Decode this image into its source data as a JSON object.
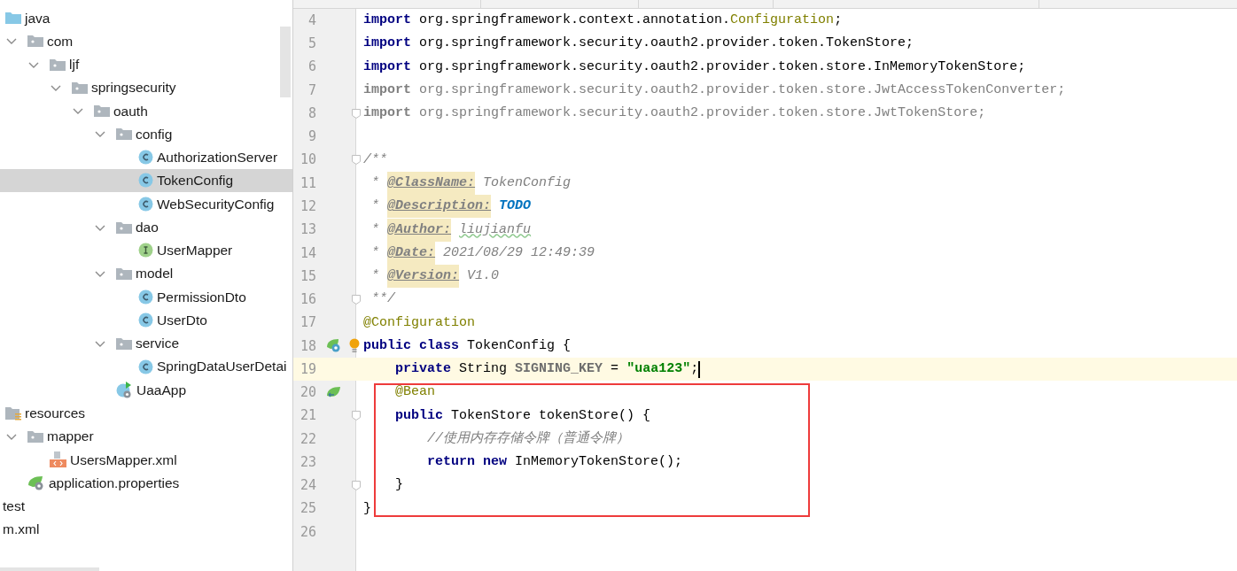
{
  "project_tree": {
    "nodes": [
      {
        "label": "java",
        "kind": "source-folder",
        "selected": false,
        "children": [
          {
            "label": "com",
            "kind": "folder",
            "selected": false,
            "expanded": true,
            "children": [
              {
                "label": "ljf",
                "kind": "folder",
                "selected": false,
                "expanded": true,
                "children": [
                  {
                    "label": "springsecurity",
                    "kind": "folder",
                    "selected": false,
                    "expanded": true,
                    "children": [
                      {
                        "label": "oauth",
                        "kind": "folder",
                        "selected": false,
                        "expanded": true,
                        "children": [
                          {
                            "label": "config",
                            "kind": "folder",
                            "selected": false,
                            "expanded": true,
                            "children": [
                              {
                                "label": "AuthorizationServer",
                                "kind": "class",
                                "selected": false
                              },
                              {
                                "label": "TokenConfig",
                                "kind": "class",
                                "selected": true
                              },
                              {
                                "label": "WebSecurityConfig",
                                "kind": "class",
                                "selected": false
                              }
                            ]
                          },
                          {
                            "label": "dao",
                            "kind": "folder",
                            "selected": false,
                            "expanded": true,
                            "children": [
                              {
                                "label": "UserMapper",
                                "kind": "interface",
                                "selected": false
                              }
                            ]
                          },
                          {
                            "label": "model",
                            "kind": "folder",
                            "selected": false,
                            "expanded": true,
                            "children": [
                              {
                                "label": "PermissionDto",
                                "kind": "class",
                                "selected": false
                              },
                              {
                                "label": "UserDto",
                                "kind": "class",
                                "selected": false
                              }
                            ]
                          },
                          {
                            "label": "service",
                            "kind": "folder",
                            "selected": false,
                            "expanded": true,
                            "children": [
                              {
                                "label": "SpringDataUserDetai",
                                "kind": "class",
                                "selected": false
                              }
                            ]
                          },
                          {
                            "label": "UaaApp",
                            "kind": "app",
                            "selected": false
                          }
                        ]
                      }
                    ]
                  }
                ]
              }
            ]
          }
        ]
      },
      {
        "label": "resources",
        "kind": "resources-folder",
        "selected": false,
        "children": [
          {
            "label": "mapper",
            "kind": "folder",
            "selected": false,
            "expanded": true,
            "children": [
              {
                "label": "UsersMapper.xml",
                "kind": "xml",
                "selected": false
              }
            ]
          },
          {
            "label": "application.properties",
            "kind": "properties",
            "selected": false
          }
        ]
      }
    ],
    "outer_nodes": [
      {
        "label": "test",
        "selected": false
      },
      {
        "label": "m.xml",
        "selected": false
      }
    ]
  },
  "editor": {
    "lines": [
      {
        "number": "4",
        "current": false,
        "tokens": [
          {
            "kind": "keyword",
            "text": "import"
          },
          {
            "kind": "plain",
            "text": " org.springframework.context.annotation."
          },
          {
            "kind": "annotation",
            "text": "Configuration"
          },
          {
            "kind": "plain",
            "text": ";"
          }
        ]
      },
      {
        "number": "5",
        "current": false,
        "tokens": [
          {
            "kind": "keyword",
            "text": "import"
          },
          {
            "kind": "plain",
            "text": " org.springframework.security.oauth2.provider.token.TokenStore;"
          }
        ]
      },
      {
        "number": "6",
        "current": false,
        "tokens": [
          {
            "kind": "keyword",
            "text": "import"
          },
          {
            "kind": "plain",
            "text": " org.springframework.security.oauth2.provider.token.store.InMemoryTokenStore;"
          }
        ]
      },
      {
        "number": "7",
        "current": false,
        "tokens": [
          {
            "kind": "unused-keyword",
            "text": "import"
          },
          {
            "kind": "unused",
            "text": " org.springframework.security.oauth2.provider.token.store.JwtAccessTokenConverter;"
          }
        ]
      },
      {
        "number": "8",
        "current": false,
        "fold": true,
        "tokens": [
          {
            "kind": "unused-keyword",
            "text": "import"
          },
          {
            "kind": "unused",
            "text": " org.springframework.security.oauth2.provider.token.store.JwtTokenStore;"
          }
        ]
      },
      {
        "number": "9",
        "current": false
      },
      {
        "number": "10",
        "current": false,
        "fold": true,
        "tokens": [
          {
            "kind": "comment",
            "text": "/**"
          }
        ]
      },
      {
        "number": "11",
        "current": false,
        "tokens": [
          {
            "kind": "comment",
            "text": " * "
          },
          {
            "kind": "doc-tag",
            "text": "@ClassName:"
          },
          {
            "kind": "comment",
            "text": " TokenConfig"
          }
        ]
      },
      {
        "number": "12",
        "current": false,
        "tokens": [
          {
            "kind": "comment",
            "text": " * "
          },
          {
            "kind": "doc-tag",
            "text": "@Description:"
          },
          {
            "kind": "todo",
            "text": " TODO"
          }
        ]
      },
      {
        "number": "13",
        "current": false,
        "tokens": [
          {
            "kind": "comment",
            "text": " * "
          },
          {
            "kind": "doc-tag",
            "text": "@Author:"
          },
          {
            "kind": "typo",
            "text": " liujianfu"
          }
        ]
      },
      {
        "number": "14",
        "current": false,
        "tokens": [
          {
            "kind": "comment",
            "text": " * "
          },
          {
            "kind": "doc-tag",
            "text": "@Date:"
          },
          {
            "kind": "comment",
            "text": " 2021/08/29 12:49:39"
          }
        ]
      },
      {
        "number": "15",
        "current": false,
        "tokens": [
          {
            "kind": "comment",
            "text": " * "
          },
          {
            "kind": "doc-tag",
            "text": "@Version:"
          },
          {
            "kind": "comment",
            "text": " V1.0"
          }
        ]
      },
      {
        "number": "16",
        "current": false,
        "fold": true,
        "tokens": [
          {
            "kind": "comment",
            "text": " **/"
          }
        ]
      },
      {
        "number": "17",
        "current": false,
        "tokens": [
          {
            "kind": "annotation",
            "text": "@Configuration"
          }
        ]
      },
      {
        "number": "18",
        "current": false,
        "gutter_marker": {
          "kind": "bean-run"
        },
        "bulb": true,
        "tokens": [
          {
            "kind": "keyword",
            "text": "public"
          },
          {
            "kind": "keyword",
            "text": " class"
          },
          {
            "kind": "plain",
            "text": " TokenConfig {"
          }
        ]
      },
      {
        "number": "19",
        "current": true,
        "caret": true,
        "tokens": [
          {
            "kind": "keyword",
            "text": "    private"
          },
          {
            "kind": "plain",
            "text": " String "
          },
          {
            "kind": "field",
            "text": "SIGNING_KEY"
          },
          {
            "kind": "plain",
            "text": " = "
          },
          {
            "kind": "string",
            "text": "\"uaa123\""
          },
          {
            "kind": "plain",
            "text": ";"
          }
        ]
      },
      {
        "number": "20",
        "current": false,
        "gutter_marker": {
          "kind": "bean"
        },
        "tokens": [
          {
            "kind": "annotation",
            "text": "    @Bean"
          }
        ]
      },
      {
        "number": "21",
        "current": false,
        "fold": true,
        "tokens": [
          {
            "kind": "keyword",
            "text": "    public"
          },
          {
            "kind": "plain",
            "text": " TokenStore tokenStore() {"
          }
        ]
      },
      {
        "number": "22",
        "current": false,
        "tokens": [
          {
            "kind": "comment",
            "text": "        //使用内存存储令牌（普通令牌）"
          }
        ]
      },
      {
        "number": "23",
        "current": false,
        "tokens": [
          {
            "kind": "keyword",
            "text": "        return"
          },
          {
            "kind": "keyword",
            "text": " new"
          },
          {
            "kind": "plain",
            "text": " InMemoryTokenStore();"
          }
        ]
      },
      {
        "number": "24",
        "current": false,
        "fold": true,
        "tokens": [
          {
            "kind": "plain",
            "text": "    }"
          }
        ]
      },
      {
        "number": "25",
        "current": false,
        "tokens": [
          {
            "kind": "plain",
            "text": "}"
          }
        ]
      },
      {
        "number": "26",
        "current": false
      }
    ]
  }
}
